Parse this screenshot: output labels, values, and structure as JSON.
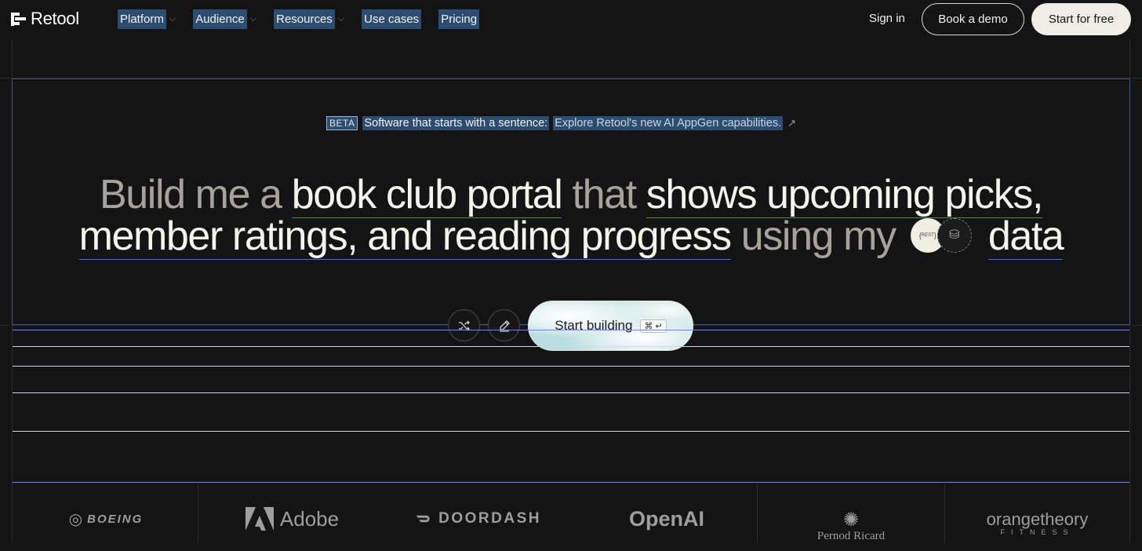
{
  "brand": {
    "name": "Retool"
  },
  "nav": {
    "items": [
      {
        "label": "Platform",
        "has_menu": true
      },
      {
        "label": "Audience",
        "has_menu": true
      },
      {
        "label": "Resources",
        "has_menu": true
      },
      {
        "label": "Use cases",
        "has_menu": false
      },
      {
        "label": "Pricing",
        "has_menu": false
      }
    ],
    "sign_in": "Sign in",
    "book_demo": "Book a demo",
    "start_free": "Start for free"
  },
  "banner": {
    "badge": "BETA",
    "text": "Software that starts with a sentence:",
    "link": "Explore Retool's new AI AppGen capabilities.",
    "link_icon": "external-arrow-icon"
  },
  "headline": {
    "line1": {
      "a": "Build me a",
      "b": "book club portal",
      "c": "that",
      "d": "shows upcoming picks,"
    },
    "line2": {
      "a": "member ratings, and reading progress",
      "b": "using my",
      "c": "data"
    },
    "rest_chip": "REST",
    "db_chip_icon": "database-icon"
  },
  "actions": {
    "shuffle_icon": "shuffle-icon",
    "edit_icon": "pencil-icon",
    "start_building": "Start building",
    "shortcut": "⌘ ↵"
  },
  "customer_logos": {
    "boeing": "BOEING",
    "adobe": "Adobe",
    "doordash": "DOORDASH",
    "openai": "OpenAI",
    "pernod": "Pernod Ricard",
    "orangetheory": "orangetheory",
    "orangetheory_sub": "FITNESS"
  },
  "colors": {
    "background": "#141414",
    "selection": "#2c4d6f",
    "underline": "#4d79b8",
    "cta_bg": "#efeee6"
  }
}
